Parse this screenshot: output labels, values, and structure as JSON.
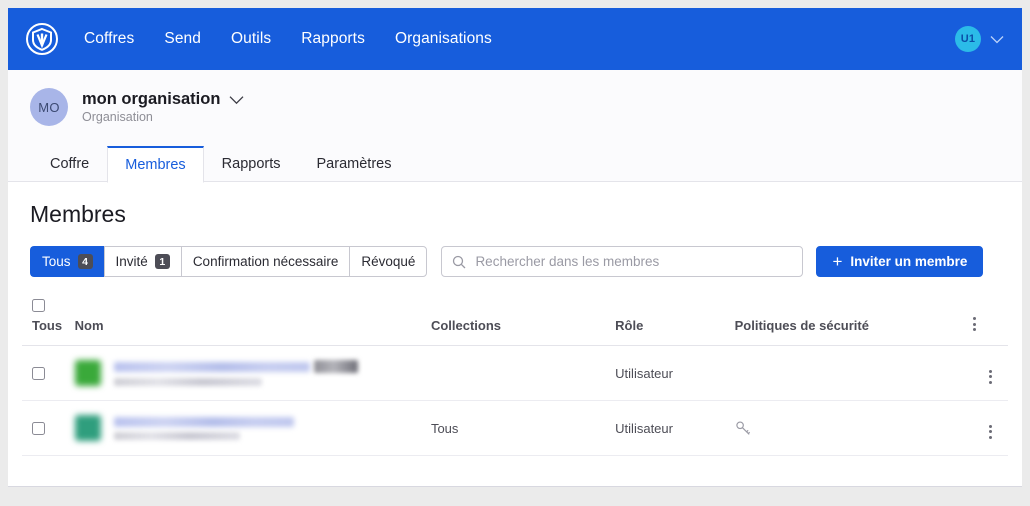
{
  "topnav": {
    "logo_icon": "shield-v-logo-icon",
    "links": [
      "Coffres",
      "Send",
      "Outils",
      "Rapports",
      "Organisations"
    ],
    "account_initials": "U1",
    "account_chevron_icon": "chevron-down-icon",
    "background_color": "#175ddc"
  },
  "org_header": {
    "initials": "MO",
    "name": "mon organisation",
    "subtitle": "Organisation",
    "chevron_icon": "chevron-down-icon",
    "avatar_color": "#a8b5e8"
  },
  "tabs": [
    {
      "label": "Coffre",
      "active": false
    },
    {
      "label": "Membres",
      "active": true
    },
    {
      "label": "Rapports",
      "active": false
    },
    {
      "label": "Paramètres",
      "active": false
    }
  ],
  "main": {
    "page_title": "Membres",
    "filters": [
      {
        "label": "Tous",
        "count": "4",
        "active": true
      },
      {
        "label": "Invité",
        "count": "1",
        "active": false
      },
      {
        "label": "Confirmation nécessaire",
        "count": "",
        "active": false
      },
      {
        "label": "Révoqué",
        "count": "",
        "active": false
      }
    ],
    "search": {
      "icon": "search-icon",
      "placeholder": "Rechercher dans les membres",
      "value": ""
    },
    "invite_button": {
      "label": "Inviter un membre",
      "icon": "plus-icon",
      "color": "#175ddc"
    },
    "table": {
      "headers": {
        "select_all": "Tous",
        "name": "Nom",
        "collections": "Collections",
        "role": "Rôle",
        "policies": "Politiques de sécurité",
        "menu_icon": "kebab-menu-icon"
      },
      "rows": [
        {
          "selected": false,
          "avatar_color": "#3aa93a",
          "name_redacted": true,
          "name_width": 196,
          "has_tag": true,
          "email_width": 148,
          "collections": "",
          "role": "Utilisateur",
          "policy_icon": "",
          "menu_icon": "kebab-menu-icon"
        },
        {
          "selected": false,
          "avatar_color": "#2f9e7d",
          "name_redacted": true,
          "name_width": 180,
          "has_tag": false,
          "email_width": 126,
          "collections": "Tous",
          "role": "Utilisateur",
          "policy_icon": "key-icon",
          "menu_icon": "kebab-menu-icon"
        }
      ]
    }
  }
}
